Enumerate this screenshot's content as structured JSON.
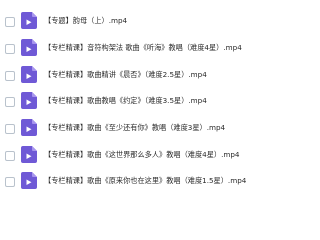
{
  "files": [
    {
      "name": "【专题】韵母（上）.mp4",
      "icon": "video-file-icon"
    },
    {
      "name": "【专栏精课】音符构架法 歌曲《听海》教唱（难度4星）.mp4",
      "icon": "video-file-icon"
    },
    {
      "name": "【专栏精课】歌曲精讲《晨否》（难度2.5星）.mp4",
      "icon": "video-file-icon"
    },
    {
      "name": "【专栏精课】歌曲教唱《约定》（难度3.5星）.mp4",
      "icon": "video-file-icon"
    },
    {
      "name": "【专栏精课】歌曲《至少还有你》教唱（难度3星）.mp4",
      "icon": "video-file-icon"
    },
    {
      "name": "【专栏精课】歌曲《这世界那么多人》教唱（难度4星）.mp4",
      "icon": "video-file-icon"
    },
    {
      "name": "【专栏精课】歌曲《原来你也在这里》教唱（难度1.5星）.mp4",
      "icon": "video-file-icon"
    }
  ],
  "colors": {
    "icon": "#6f59d6",
    "text": "#2b2b2b",
    "checkbox_border": "#b9c2cc"
  }
}
